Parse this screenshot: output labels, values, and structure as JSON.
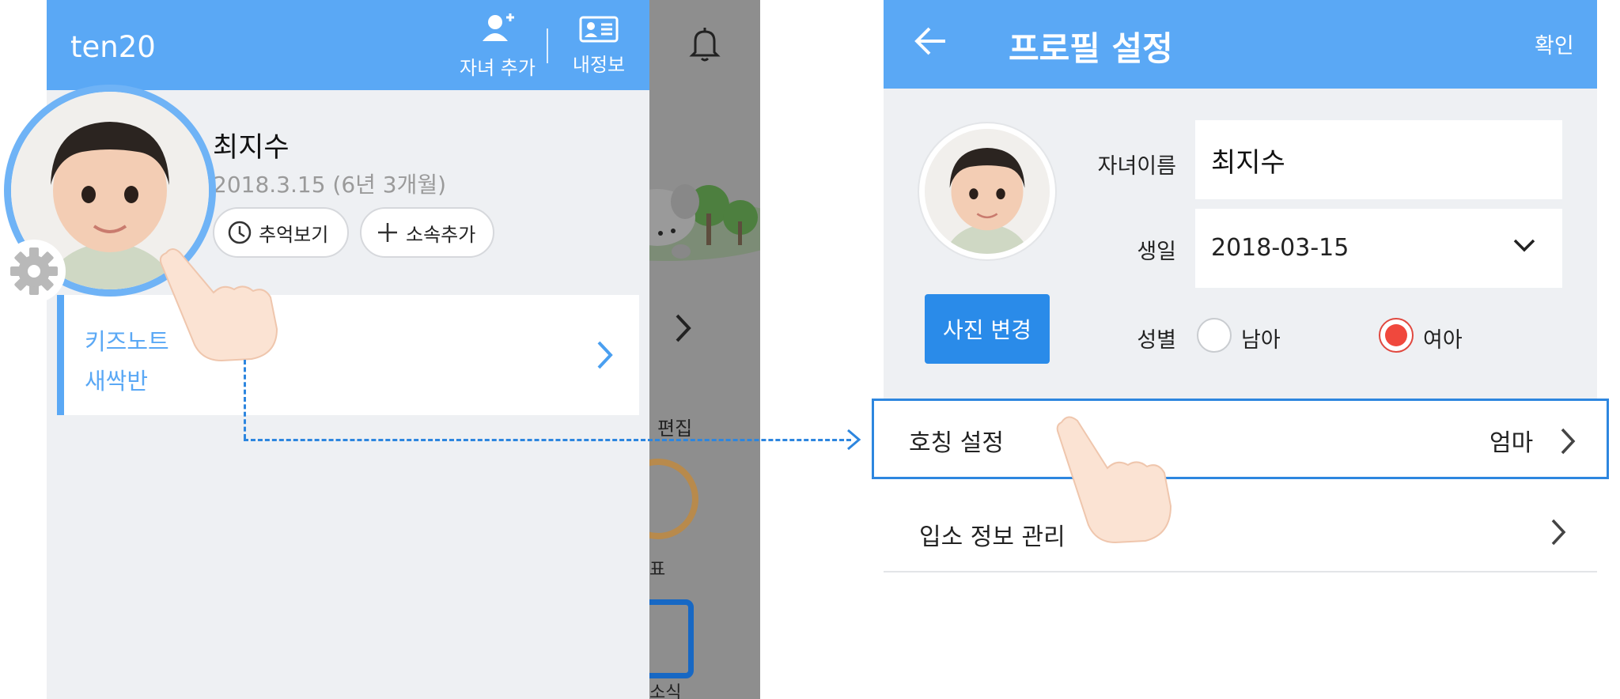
{
  "left_screen": {
    "app_title": "ten20",
    "header": {
      "add_child_label": "자녀 추가",
      "my_info_label": "내정보"
    },
    "child": {
      "name": "최지수",
      "birth": "2018.3.15 (6년 3개월)",
      "memories_label": "추억보기",
      "add_affiliation_label": "소속추가"
    },
    "class_card": {
      "org": "키즈노트 ",
      "class_name": "새싹반"
    }
  },
  "middle_panel": {
    "edit_label": "편집",
    "text_2": "표",
    "text_3": "소식"
  },
  "right_screen": {
    "title": "프로필 설정",
    "confirm_label": "확인",
    "photo_change_label": "사진 변경",
    "name_label": "자녀이름",
    "name_value": "최지수",
    "birth_label": "생일",
    "birth_value": "2018-03-15",
    "gender_label": "성별",
    "gender_options": [
      "남아",
      "여아"
    ],
    "gender_selected": "여아",
    "nickname_label": "호칭 설정",
    "nickname_value": "엄마",
    "admission_label": "입소 정보 관리"
  },
  "colors": {
    "header_blue": "#5aa8f5",
    "button_blue": "#2a8be9",
    "highlight_blue": "#2d86df",
    "radio_selected": "#f0483d"
  },
  "icons": [
    "add-person-icon",
    "id-card-icon",
    "bell-icon",
    "clock-icon",
    "plus-icon",
    "gear-icon",
    "chevron-right-icon",
    "back-arrow-icon",
    "chevron-down-icon",
    "pointing-hand-icon"
  ]
}
